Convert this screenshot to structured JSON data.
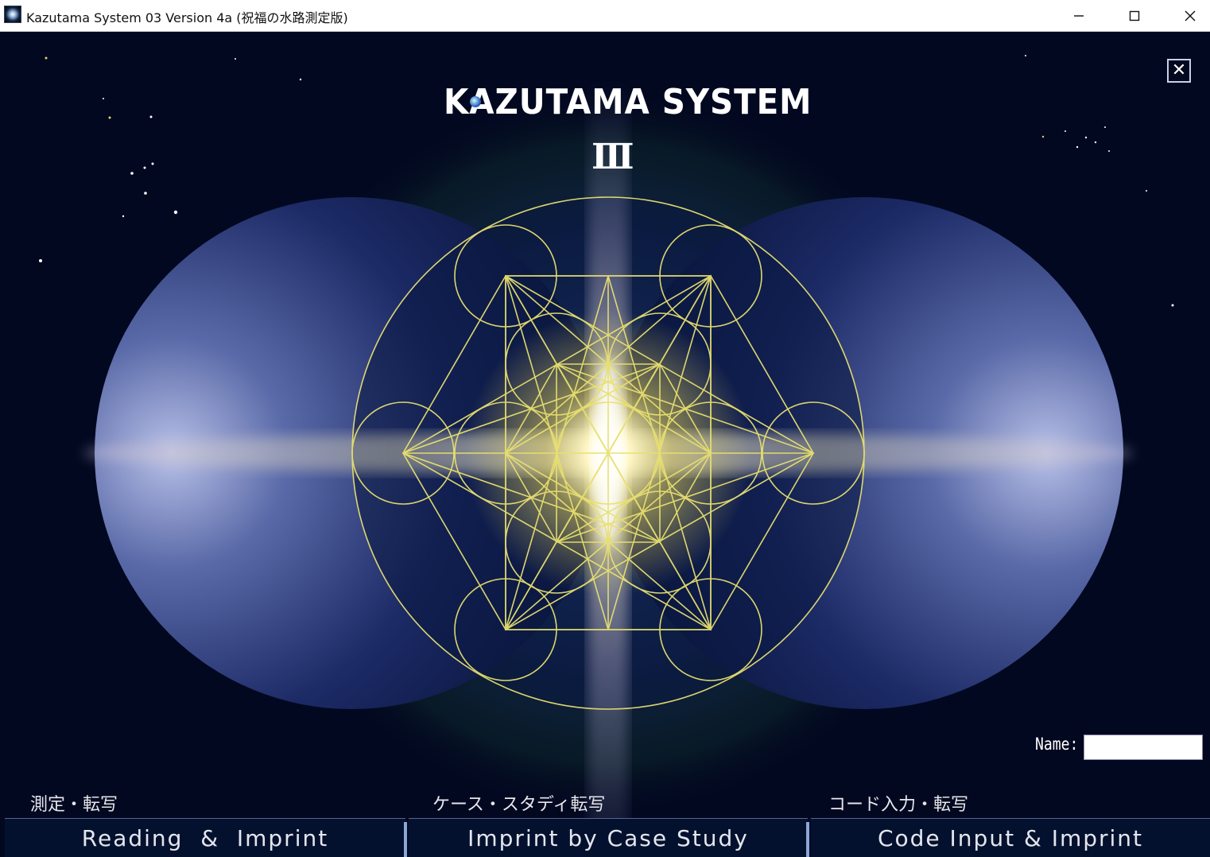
{
  "window": {
    "title": "Kazutama System 03 Version 4a (祝福の水路測定版)",
    "controls": {
      "minimize": "—",
      "maximize": "☐",
      "close": "✕"
    }
  },
  "logo": {
    "text": "KAZUTAMA SYSTEM",
    "numeral": "Ⅲ"
  },
  "close_button": {
    "glyph": "✕"
  },
  "name_field": {
    "label": "Name:",
    "value": "",
    "placeholder": ""
  },
  "nav": [
    {
      "caption": "測定・転写",
      "label": "Reading  &  Imprint"
    },
    {
      "caption": "ケース・スタディ転写",
      "label": "Imprint by Case Study"
    },
    {
      "caption": "コード入力・転写",
      "label": "Code Input & Imprint"
    }
  ],
  "colors": {
    "background": "#020820",
    "sacred_geometry": "#e8e070",
    "glow": "#fff6c0",
    "lobes": "#2a3a7a",
    "button_bg": "#04112e",
    "separator": "#8aa6d8"
  },
  "icons": [
    "app-icon",
    "minimize-icon",
    "maximize-icon",
    "close-icon",
    "metatron-cube-icon"
  ]
}
